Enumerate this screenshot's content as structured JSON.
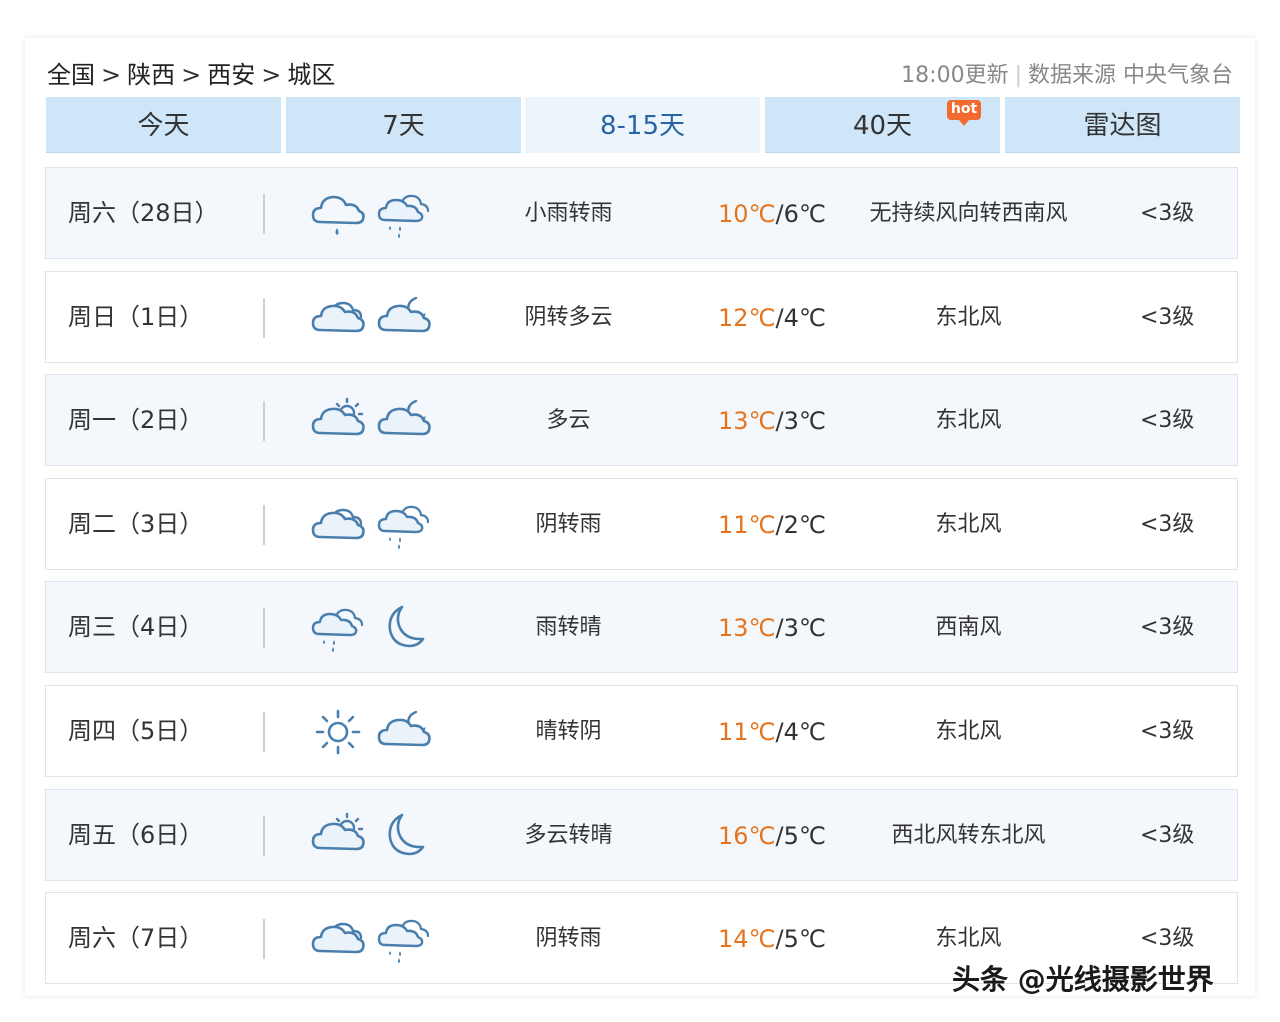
{
  "breadcrumb": {
    "items": [
      "全国",
      "陕西",
      "西安",
      "城区"
    ],
    "separator": ">"
  },
  "update_info": {
    "time": "18:00更新",
    "source": "数据来源 中央气象台"
  },
  "tabs": [
    {
      "label": "今天",
      "active": false
    },
    {
      "label": "7天",
      "active": false
    },
    {
      "label": "8-15天",
      "active": true
    },
    {
      "label": "40天",
      "active": false,
      "badge": "hot"
    },
    {
      "label": "雷达图",
      "active": false
    }
  ],
  "days": [
    {
      "date": "周六（28日）",
      "icons": [
        "rain-cloud-icon",
        "showers-cloud-icon"
      ],
      "desc": "小雨转雨",
      "high": "10℃",
      "low": "6℃",
      "wind": "无持续风向转西南风",
      "level": "<3级"
    },
    {
      "date": "周日（1日）",
      "icons": [
        "overcast-cloud-icon",
        "cloudy-night-icon"
      ],
      "desc": "阴转多云",
      "high": "12℃",
      "low": "4℃",
      "wind": "东北风",
      "level": "<3级"
    },
    {
      "date": "周一（2日）",
      "icons": [
        "partly-cloudy-day-icon",
        "cloudy-night-icon"
      ],
      "desc": "多云",
      "high": "13℃",
      "low": "3℃",
      "wind": "东北风",
      "level": "<3级"
    },
    {
      "date": "周二（3日）",
      "icons": [
        "overcast-cloud-icon",
        "showers-cloud-icon"
      ],
      "desc": "阴转雨",
      "high": "11℃",
      "low": "2℃",
      "wind": "东北风",
      "level": "<3级"
    },
    {
      "date": "周三（4日）",
      "icons": [
        "showers-cloud-icon",
        "moon-icon"
      ],
      "desc": "雨转晴",
      "high": "13℃",
      "low": "3℃",
      "wind": "西南风",
      "level": "<3级"
    },
    {
      "date": "周四（5日）",
      "icons": [
        "sun-icon",
        "cloudy-night-icon"
      ],
      "desc": "晴转阴",
      "high": "11℃",
      "low": "4℃",
      "wind": "东北风",
      "level": "<3级"
    },
    {
      "date": "周五（6日）",
      "icons": [
        "partly-cloudy-day-icon",
        "moon-icon"
      ],
      "desc": "多云转晴",
      "high": "16℃",
      "low": "5℃",
      "wind": "西北风转东北风",
      "level": "<3级"
    },
    {
      "date": "周六（7日）",
      "icons": [
        "overcast-cloud-icon",
        "showers-cloud-icon"
      ],
      "desc": "阴转雨",
      "high": "14℃",
      "low": "5℃",
      "wind": "东北风",
      "level": "<3级"
    }
  ],
  "colors": {
    "tab_bg": "#cfe6f8",
    "tab_active_bg": "#edf5fc",
    "tab_active_text": "#2a64a6",
    "high_temp": "#e5741f",
    "icon_stroke": "#4a7fad",
    "hot_badge": "#f26a2e"
  },
  "watermark": "头条 @光线摄影世界"
}
